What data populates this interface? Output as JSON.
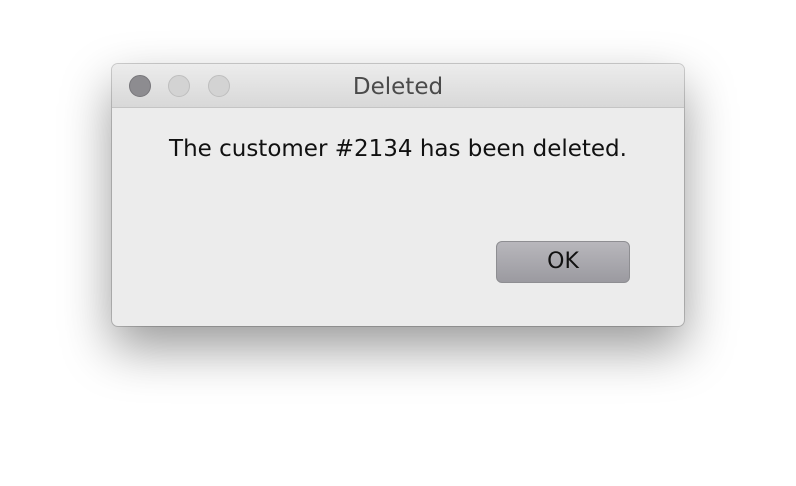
{
  "dialog": {
    "title": "Deleted",
    "message": "The customer #2134 has been deleted.",
    "ok_label": "OK"
  },
  "colors": {
    "window_background": "#ececec",
    "close_button": "#8d8c90",
    "inactive_button": "#d3d3d3",
    "ok_button": "#a9a8ad"
  },
  "icons": {
    "close": "close-icon",
    "minimize": "minimize-icon",
    "zoom": "zoom-icon"
  }
}
